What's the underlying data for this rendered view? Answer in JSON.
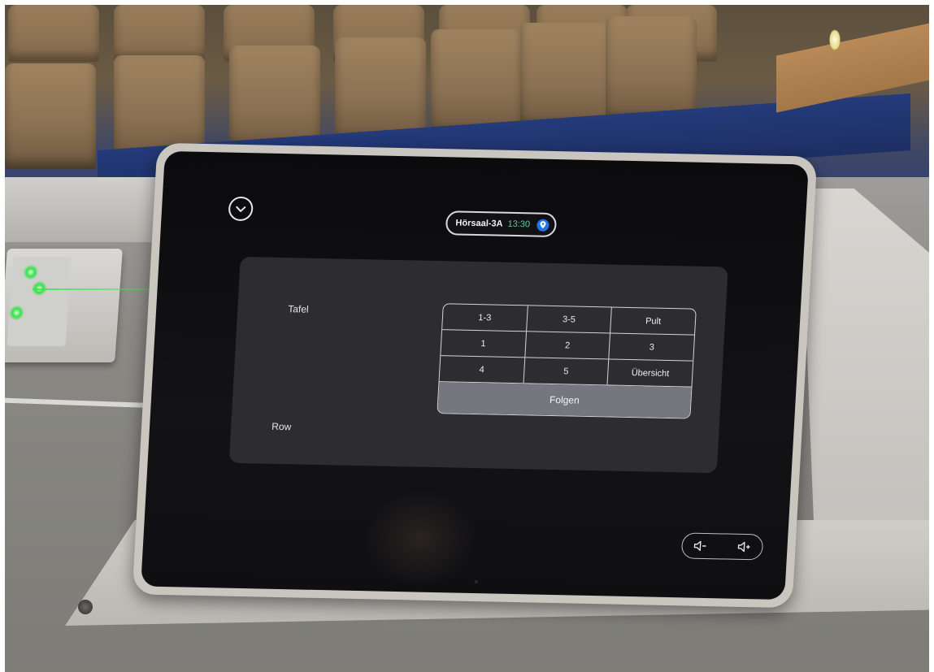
{
  "device": {
    "header": {
      "room_name": "Hörsaal-3A",
      "time": "13:30",
      "collapse_icon": "chevron-down-icon",
      "status_icon": "location-pin-icon"
    },
    "camera_panel": {
      "preset_group_label": "Tafel",
      "row_label": "Row",
      "presets": [
        [
          "1-3",
          "3-5",
          "Pult"
        ],
        [
          "1",
          "2",
          "3"
        ],
        [
          "4",
          "5",
          "Übersicht"
        ]
      ],
      "follow_label": "Folgen"
    },
    "volume": {
      "down_icon": "volume-down-icon",
      "up_icon": "volume-up-icon"
    }
  },
  "colors": {
    "screen_bg": "#0b0b0d",
    "panel_bg": "#2c2c31",
    "clock_color": "#5cd0a0",
    "status_dot": "#1e74e8",
    "follow_button_bg": "#76767e"
  }
}
